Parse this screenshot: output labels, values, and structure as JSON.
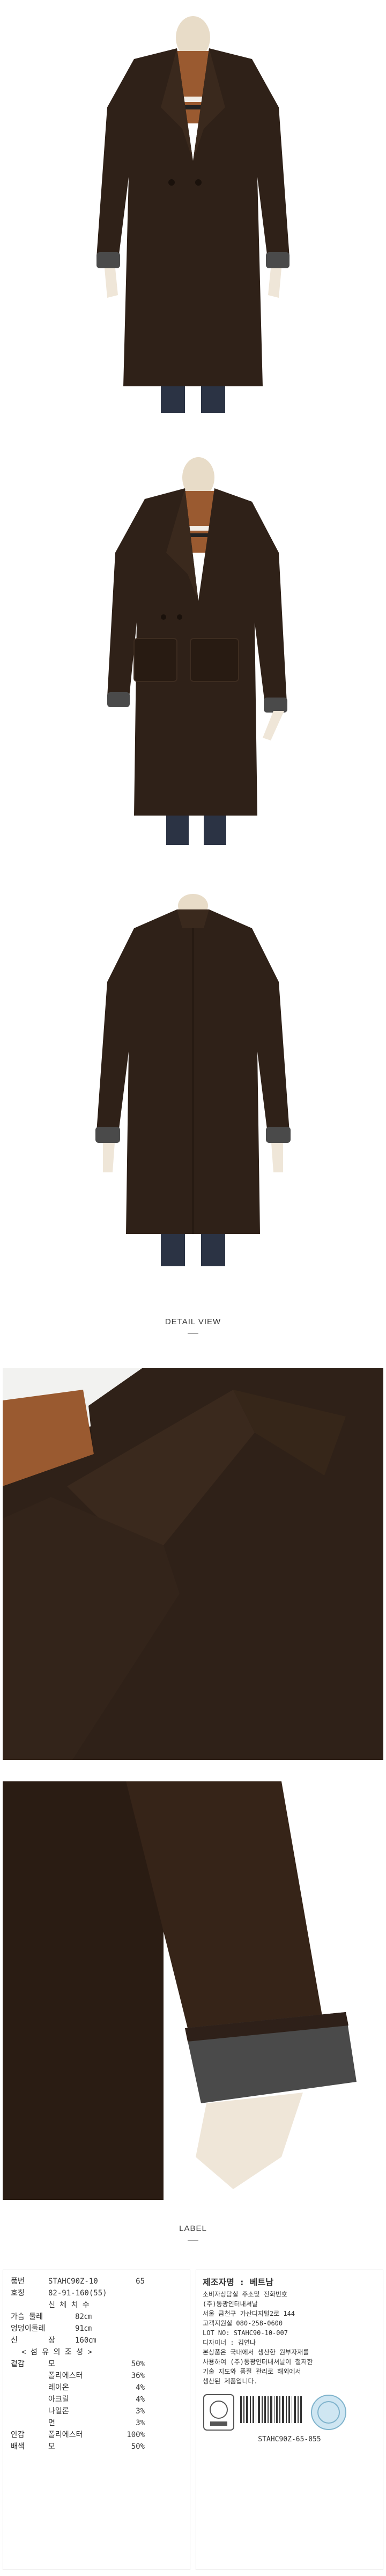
{
  "sections": {
    "detail_title": "DETAIL VIEW",
    "label_title": "LABEL"
  },
  "colors": {
    "coat": "#2f2118",
    "coat_shadow": "#1f150e",
    "sweater": "#9a5a30",
    "cuff": "#4a4a4a",
    "jeans": "#2b3344",
    "background": "#ffffff"
  },
  "label_left": {
    "line1_key": "품번",
    "line1_val": "STAHC90Z-10",
    "line1_size": "65",
    "line2_key": "호칭",
    "line2_val": "82-91-160(55)",
    "header": "신 체 치 수",
    "body_rows": [
      {
        "k": "가슴 둘레",
        "v": "82㎝"
      },
      {
        "k": "엉덩이둘레",
        "v": "91㎝"
      },
      {
        "k": "신",
        "v": "장",
        "p": "160㎝"
      }
    ],
    "fiber_header": "< 섬 유 의 조 성 >",
    "fiber_rows": [
      {
        "k": "겉감",
        "v": "모",
        "p": "50%"
      },
      {
        "k": "",
        "v": "폴리에스터",
        "p": "36%"
      },
      {
        "k": "",
        "v": "레이온",
        "p": "4%"
      },
      {
        "k": "",
        "v": "아크릴",
        "p": "4%"
      },
      {
        "k": "",
        "v": "나일론",
        "p": "3%"
      },
      {
        "k": "",
        "v": "면",
        "p": "3%"
      },
      {
        "k": "안감",
        "v": "폴리에스터",
        "p": "100%"
      },
      {
        "k": "배색",
        "v": "모",
        "p": "50%"
      }
    ]
  },
  "label_right": {
    "title": "제조자명 : 베트남",
    "lines": [
      "소비자상담실 주소및 전화번호",
      "(주)동광인터내셔날",
      "서울 금천구 가산디지털2로 144",
      "고객지원실 080-258-0600",
      "LOT NO: STAHC90-10-007",
      "디자이너 : 김연나",
      "본상품은 국내에서 생산한 원부자재를",
      "사용하여 (주)동광인터내셔날이 철저한",
      "기술 지도와 품질 관리로 해외에서",
      "생산된 제품입니다."
    ],
    "barcode_text": "STAHC90Z-65-055"
  }
}
